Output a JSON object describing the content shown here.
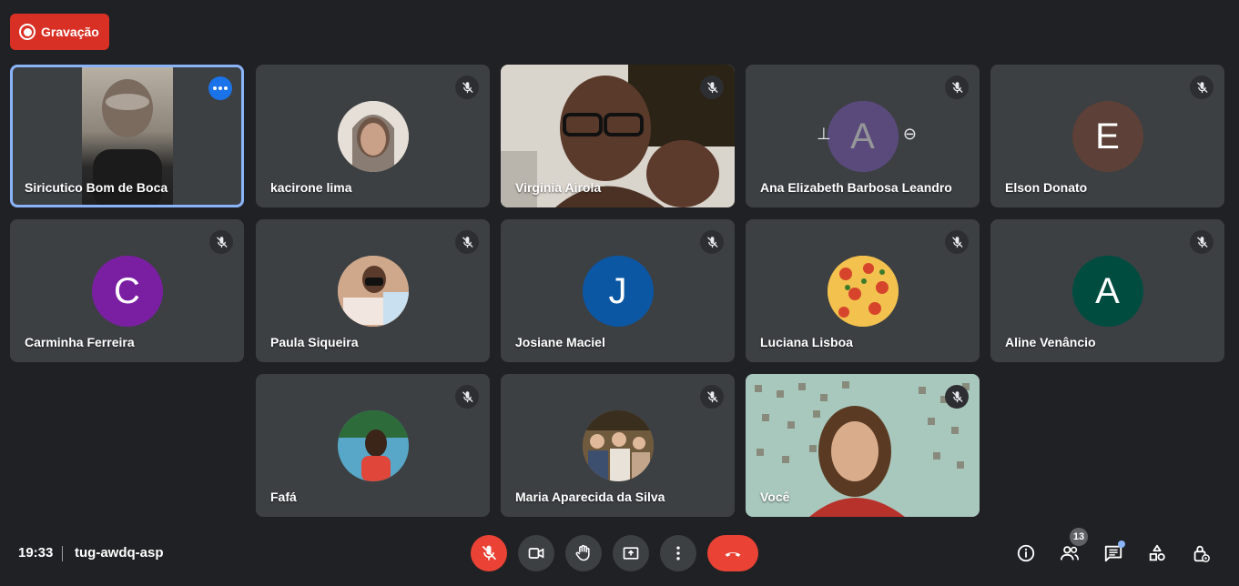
{
  "recording": {
    "label": "Gravação"
  },
  "participants": [
    {
      "name": "Siricutico Bom de Boca",
      "kind": "video",
      "active": true
    },
    {
      "name": "kacirone lima",
      "kind": "photo",
      "color": "#c9b8a8",
      "muted": true
    },
    {
      "name": "Virginia Airola",
      "kind": "video",
      "muted": true
    },
    {
      "name": "Ana Elizabeth Barbosa Leandro",
      "kind": "initial",
      "initial": "A",
      "color": "#7e57c2",
      "muted": true,
      "hover": true
    },
    {
      "name": "Elson Donato",
      "kind": "initial",
      "initial": "E",
      "color": "#5d4037",
      "muted": true
    },
    {
      "name": "Carminha Ferreira",
      "kind": "initial",
      "initial": "C",
      "color": "#7b1fa2",
      "muted": true
    },
    {
      "name": "Paula Siqueira",
      "kind": "photo",
      "color": "#d9a98f",
      "muted": true
    },
    {
      "name": "Josiane Maciel",
      "kind": "initial",
      "initial": "J",
      "color": "#0b57a4",
      "muted": true
    },
    {
      "name": "Luciana Lisboa",
      "kind": "photo",
      "color": "#e8a23a",
      "muted": true
    },
    {
      "name": "Aline Venâncio",
      "kind": "initial",
      "initial": "A",
      "color": "#004d40",
      "muted": true
    },
    {
      "name": "Fafá",
      "kind": "photo",
      "color": "#2e7d5b",
      "muted": true
    },
    {
      "name": "Maria Aparecida da Silva",
      "kind": "photo",
      "color": "#8b7355",
      "muted": true
    },
    {
      "name": "Você",
      "kind": "video",
      "muted": true
    }
  ],
  "bottombar": {
    "time": "19:33",
    "meeting_code": "tug-awdq-asp",
    "people_count": "13"
  },
  "icons": {
    "mic": "mic-off-icon",
    "camera": "camera-icon",
    "hand": "raise-hand-icon",
    "present": "present-screen-icon",
    "more": "more-options-icon",
    "hangup": "hang-up-icon",
    "info": "info-icon",
    "people": "people-icon",
    "chat": "chat-icon",
    "activities": "activities-icon",
    "host": "host-controls-icon"
  },
  "colors": {
    "background": "#202124",
    "tile": "#3c4043",
    "accent": "#8ab4f8",
    "danger": "#ea4335"
  }
}
